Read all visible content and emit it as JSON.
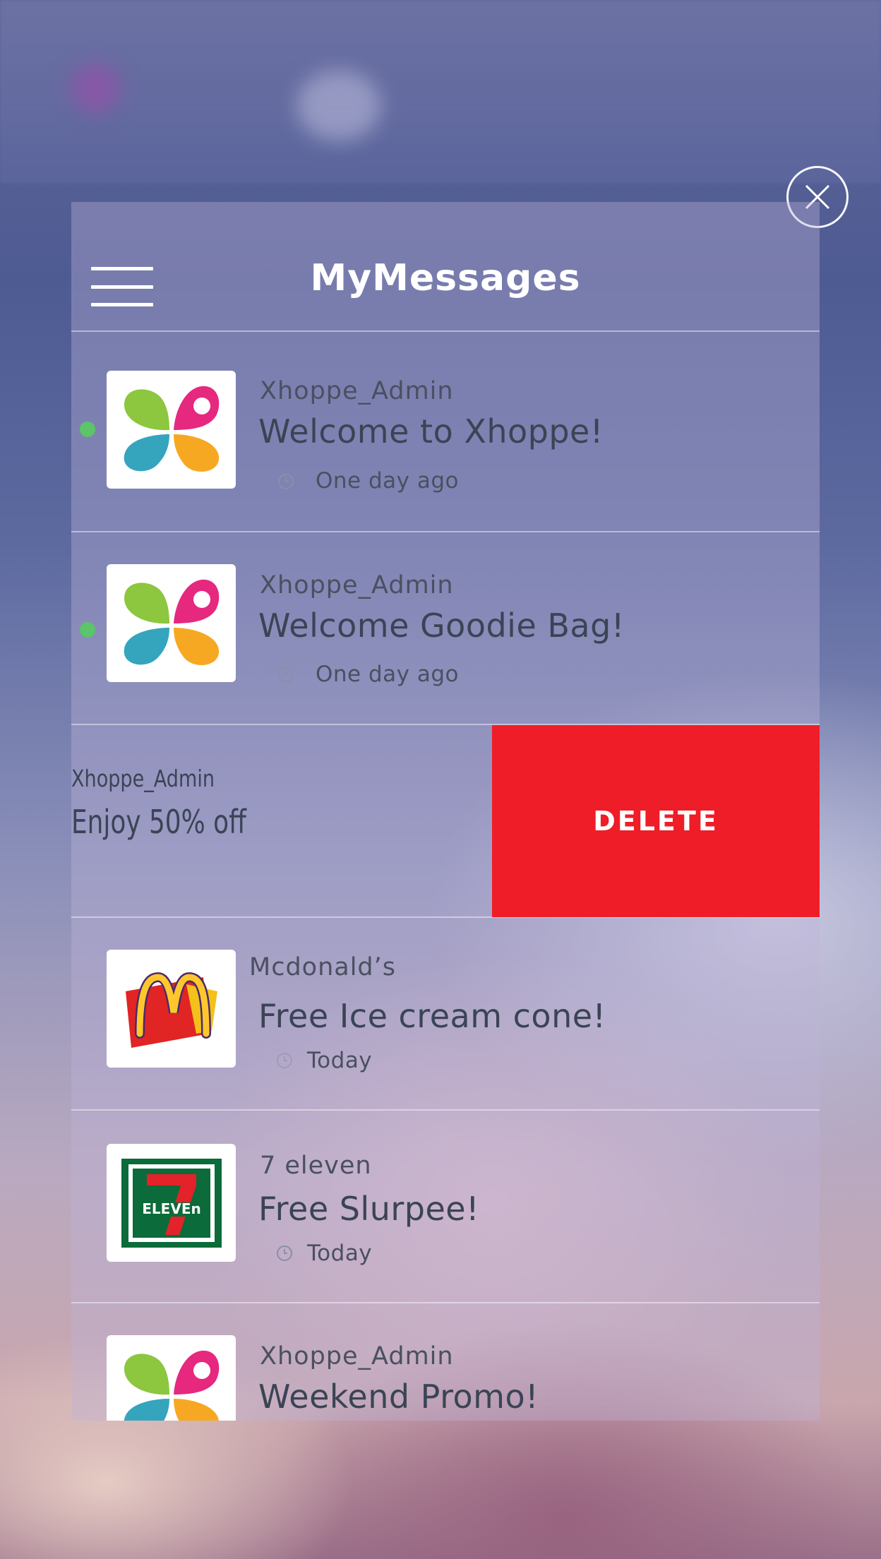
{
  "header": {
    "title": "MyMessages"
  },
  "messages": [
    {
      "sender": "Xhoppe_Admin",
      "subject": "Welcome to Xhoppe!",
      "time": "One day ago",
      "unread": true,
      "logo": "xhoppe-logo"
    },
    {
      "sender": "Xhoppe_Admin",
      "subject": "Welcome Goodie Bag!",
      "time": "One day ago",
      "unread": true,
      "logo": "xhoppe-logo"
    },
    {
      "sender": "Xhoppe_Admin",
      "subject": "Enjoy 50% off",
      "swiped": true,
      "delete_label": "DELETE"
    },
    {
      "sender": "Mcdonald’s",
      "subject": "Free Ice cream cone!",
      "time": "Today",
      "unread": false,
      "logo": "mcdonalds-logo"
    },
    {
      "sender": "7 eleven",
      "subject": "Free Slurpee!",
      "time": "Today",
      "unread": false,
      "logo": "seven-eleven-logo"
    },
    {
      "sender": "Xhoppe_Admin",
      "subject": "Weekend Promo!",
      "unread": false,
      "logo": "xhoppe-logo"
    }
  ],
  "colors": {
    "delete": "#ef1d27",
    "unread_dot": "#5cc469",
    "xhoppe_green": "#8dc63f",
    "xhoppe_pink": "#e6287f",
    "xhoppe_teal": "#35a5bd",
    "xhoppe_orange": "#f7a823"
  }
}
